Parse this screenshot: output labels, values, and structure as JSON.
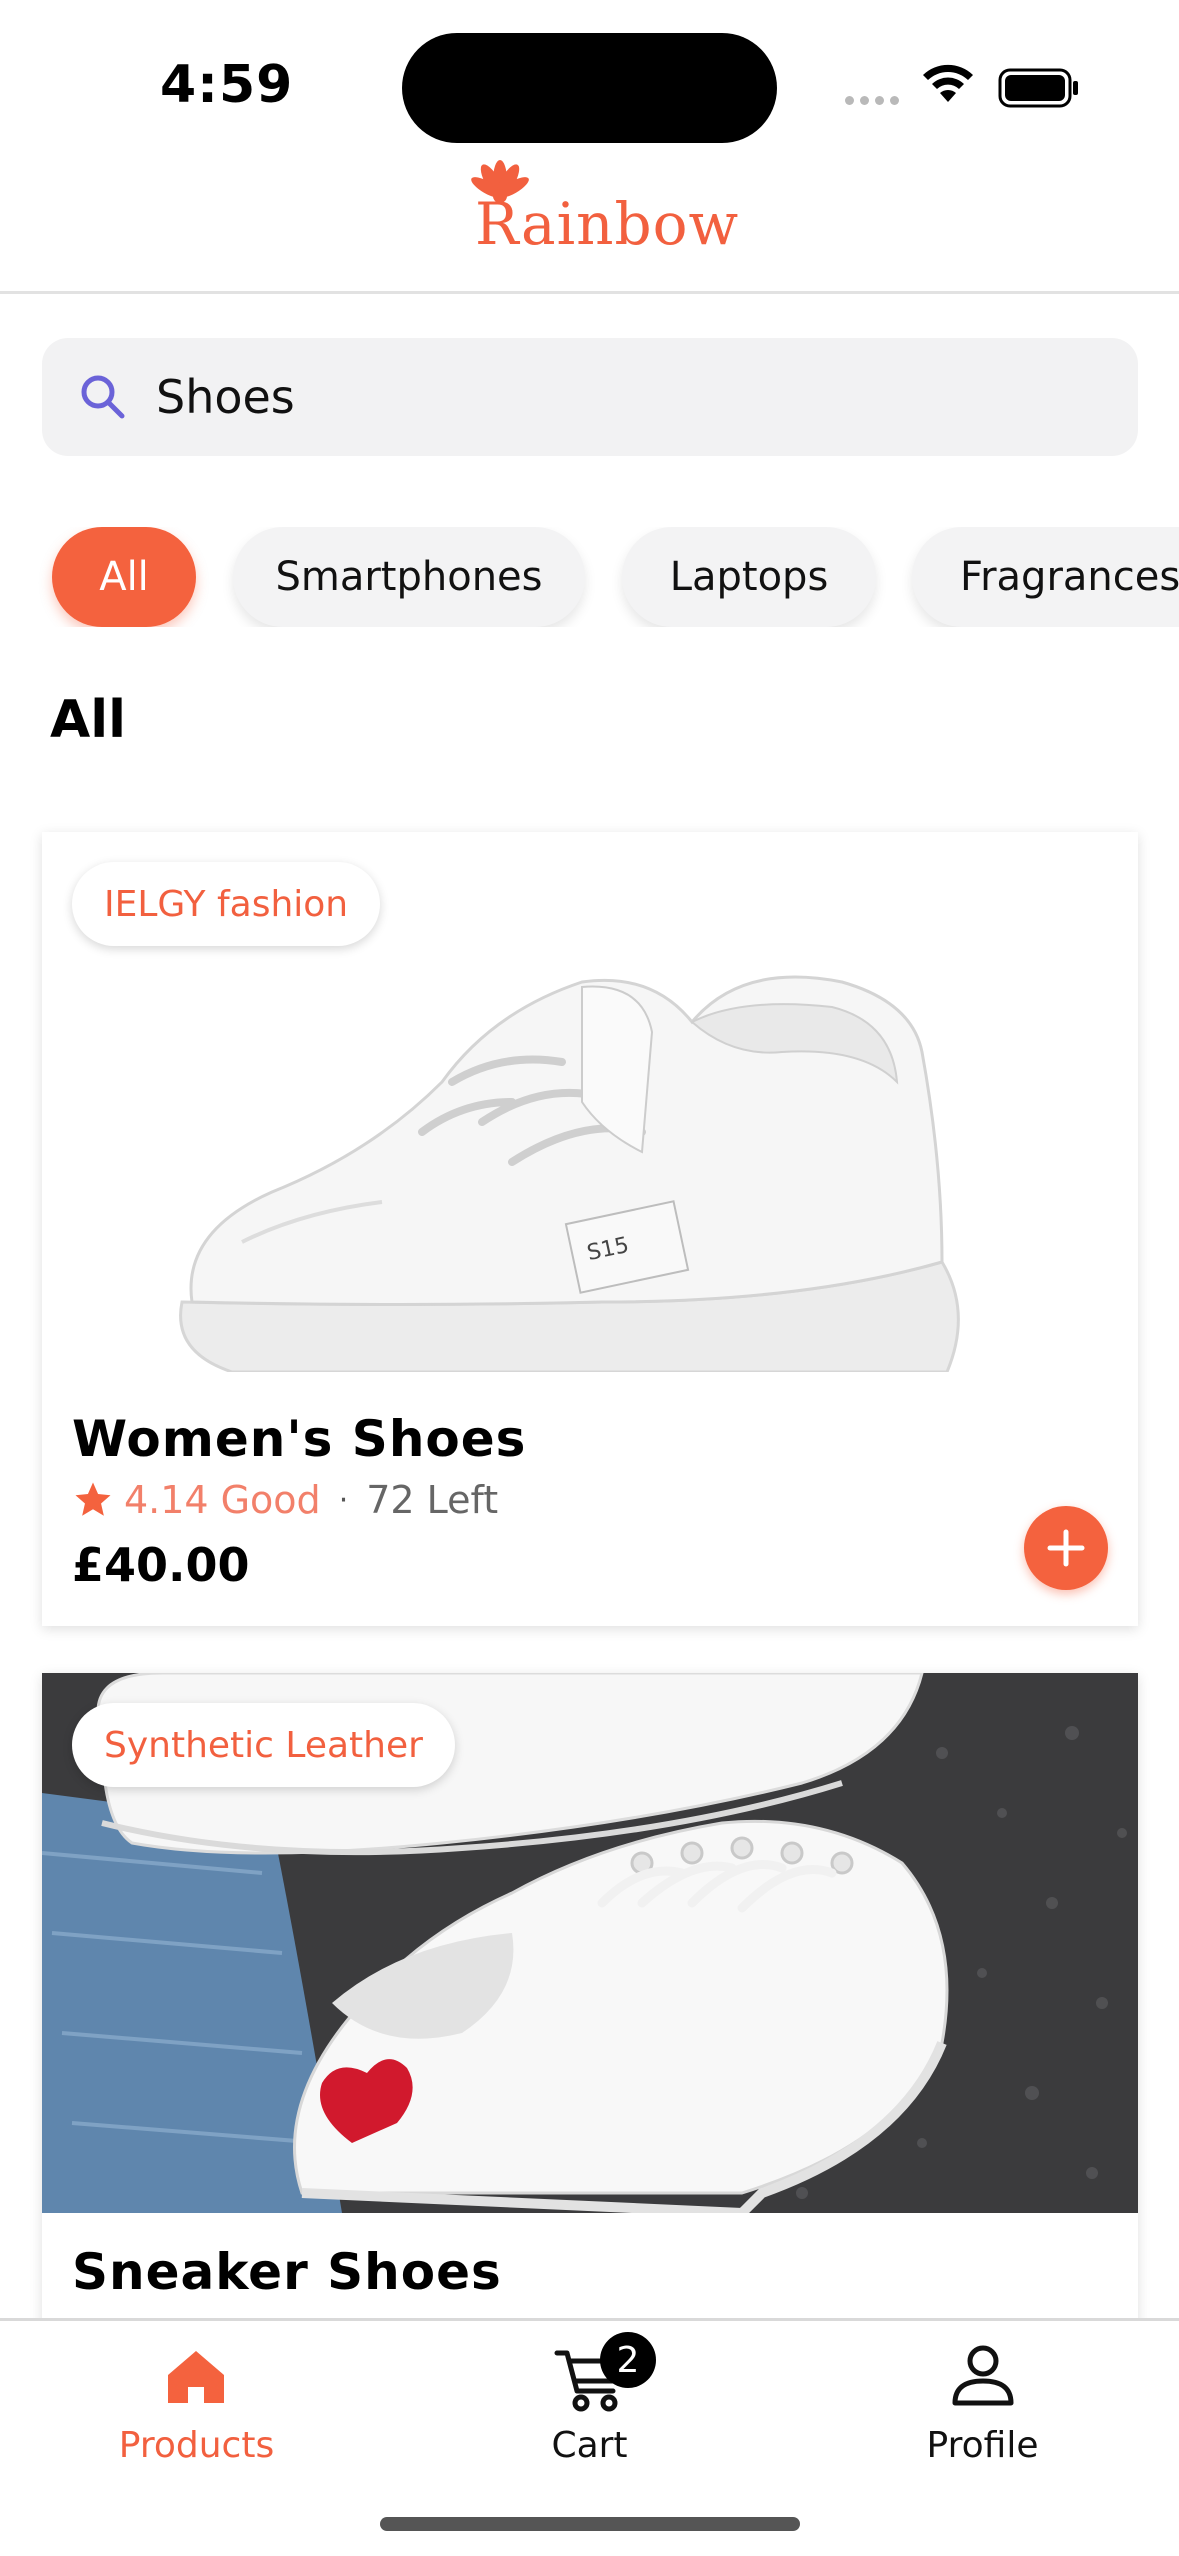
{
  "status_bar": {
    "time": "4:59"
  },
  "brand": {
    "name": "Rainbow"
  },
  "search": {
    "value": "Shoes",
    "placeholder": ""
  },
  "categories": [
    "All",
    "Smartphones",
    "Laptops",
    "Fragrances"
  ],
  "selected_category": "All",
  "section_title": "All",
  "products": [
    {
      "brand": "IELGY fashion",
      "name": "Women's Shoes",
      "rating": "4.14",
      "rating_label": "Good",
      "stock": "72 Left",
      "separator": "·",
      "price": "£40.00"
    },
    {
      "brand": "Synthetic Leather",
      "name": "Sneaker Shoes"
    }
  ],
  "tabbar": {
    "products_label": "Products",
    "cart_label": "Cart",
    "cart_count": "2",
    "profile_label": "Profile"
  },
  "colors": {
    "accent": "#f4623e",
    "rating": "#f2806a",
    "chip_bg": "#f3f3f4"
  },
  "icons": [
    "search-icon",
    "wifi-icon",
    "battery-icon",
    "star-icon",
    "plus-icon",
    "home-icon",
    "cart-icon",
    "user-icon"
  ]
}
